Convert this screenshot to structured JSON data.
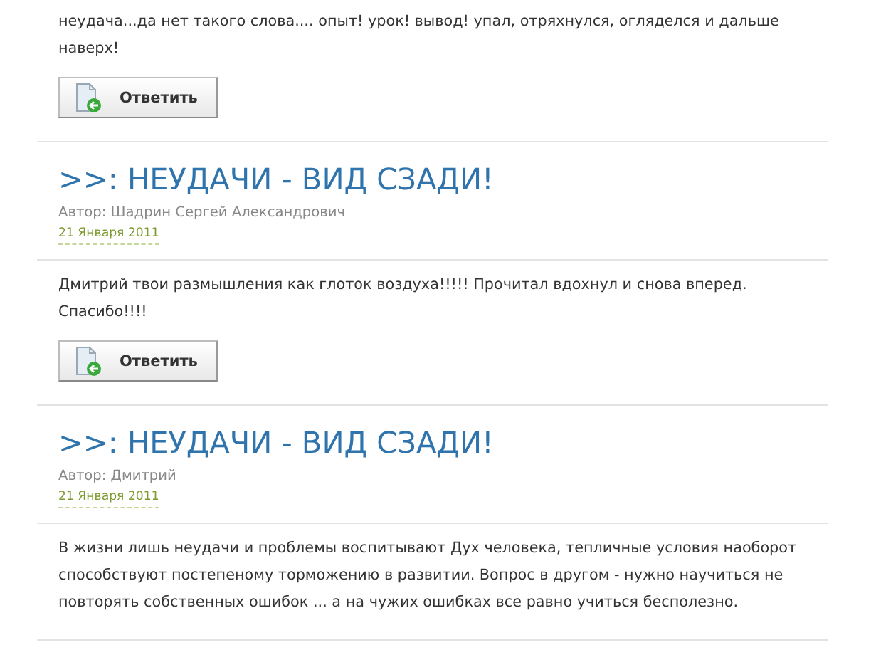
{
  "comments": [
    {
      "body": "неудача...да нет такого слова.... опыт! урок! вывод! упал, отряхнулся, огляделся и дальше наверх!",
      "reply_button": "Ответить"
    },
    {
      "title": ">>: НЕУДАЧИ - ВИД СЗАДИ!",
      "author": "Автор: Шадрин Сергей Александрович",
      "date": "21 Января 2011",
      "body": "Дмитрий твои размышления как глоток воздуха!!!!! Прочитал вдохнул и снова вперед. Спасибо!!!!",
      "reply_button": "Ответить"
    },
    {
      "title": ">>: НЕУДАЧИ - ВИД СЗАДИ!",
      "author": "Автор: Дмитрий",
      "date": "21 Января 2011",
      "body": "В жизни лишь неудачи и проблемы воспитывают Дух человека, тепличные условия наоборот способствуют постепеному торможению в развитии. Вопрос в другом - нужно научиться не повторять собственных ошибок ... а на чужих ошибках все равно учиться бесполезно."
    }
  ]
}
